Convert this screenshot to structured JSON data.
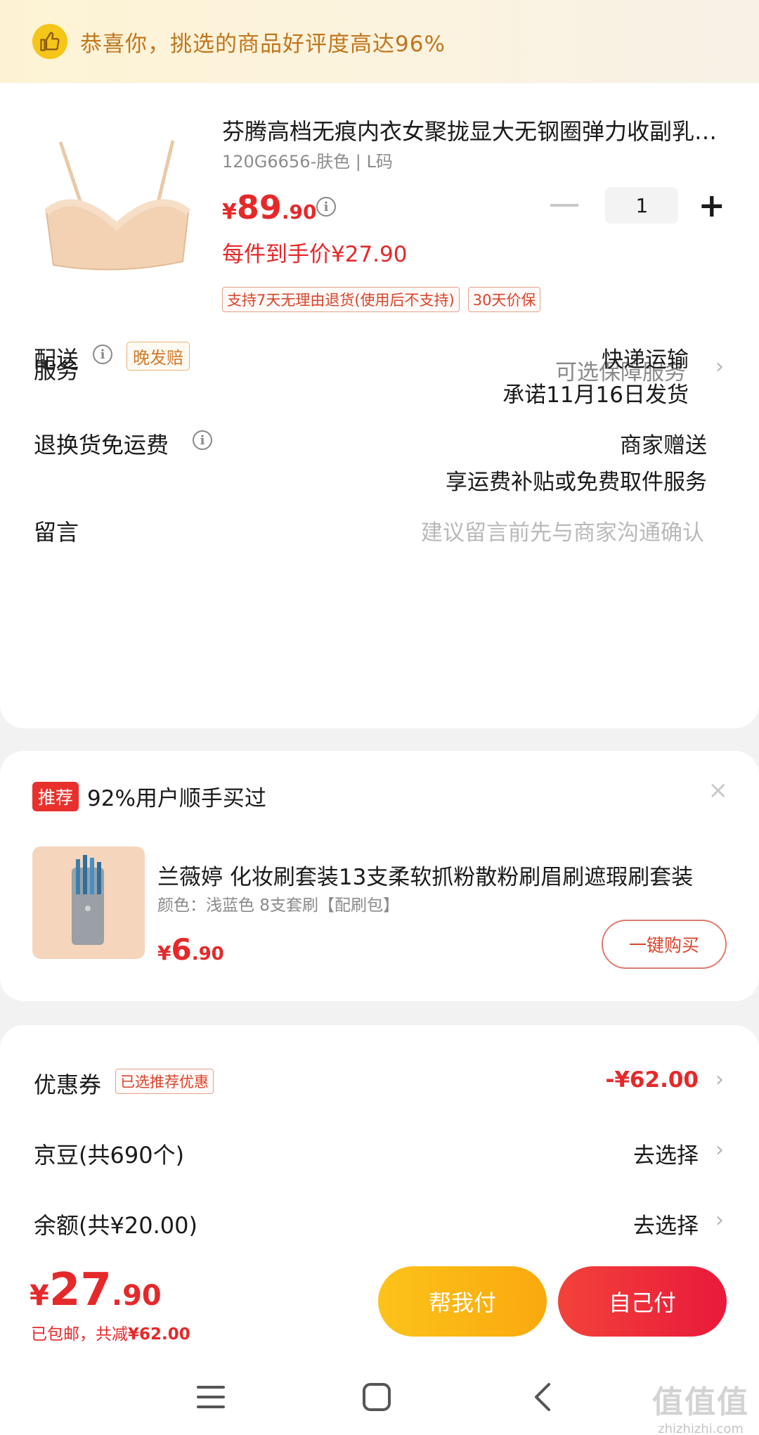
{
  "banner": {
    "text": "恭喜你，挑选的商品好评度高达96%",
    "icon": "thumbs-up-icon"
  },
  "product": {
    "title": "芬腾高档无痕内衣女聚拢显大无钢圈弹力收副乳文胸",
    "spec": "120G6656-肤色 | L码",
    "price_currency": "¥",
    "price_int": "89",
    "price_dec": ".90",
    "deal_price": "每件到手价¥27.90",
    "tags": [
      "支持7天无理由退货(使用后不支持)",
      "30天价保"
    ],
    "quantity": "1"
  },
  "rows": {
    "service_label": "服务",
    "service_value": "可选保障服务",
    "delivery_label": "配送",
    "delivery_tag": "晚发赔",
    "delivery_method": "快递运输",
    "delivery_promise": "承诺11月16日发货",
    "return_label": "退换货免运费",
    "return_value1": "商家赠送",
    "return_value2": "享运费补贴或免费取件服务",
    "message_label": "留言",
    "message_placeholder": "建议留言前先与商家沟通确认"
  },
  "recommend": {
    "badge": "推荐",
    "title": "92%用户顺手买过",
    "close": "×",
    "item_name": "兰薇婷 化妆刷套装13支柔软抓粉散粉刷眉刷遮瑕刷套装",
    "item_spec": "颜色：浅蓝色 8支套刷【配刷包】",
    "price_currency": "¥",
    "price_int": "6",
    "price_dec": ".90",
    "buy_label": "一键购买"
  },
  "discounts": {
    "coupon_label": "优惠券",
    "coupon_tag": "已选推荐优惠",
    "coupon_value": "-¥62.00",
    "beans_label": "京豆(共690个)",
    "beans_value": "去选择",
    "balance_label": "余额(共¥20.00)",
    "balance_value": "去选择"
  },
  "pay": {
    "currency": "¥",
    "total_int": "27",
    "total_dec": ".90",
    "sub_text": "已包邮，共减",
    "sub_amount": "¥62.00",
    "help_pay": "帮我付",
    "self_pay": "自己付"
  },
  "watermark": {
    "big": "值值值",
    "small": "zhizhizhi.com"
  },
  "colors": {
    "accent_red": "#e5292a",
    "gold": "#f9a90e",
    "banner_text": "#c0761d"
  }
}
